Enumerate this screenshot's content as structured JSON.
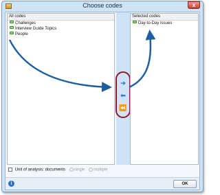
{
  "window": {
    "title": "Choose codes",
    "close_glyph": "x"
  },
  "all_codes": {
    "header": "All codes",
    "items": [
      "Challenges",
      "Interview Guide Topics",
      "People"
    ]
  },
  "selected_codes": {
    "header": "Selected codes",
    "items": [
      "Day-to-Day Issues"
    ]
  },
  "mover_buttons": [
    {
      "glyph": "➔",
      "icon": "arrow-right-icon"
    },
    {
      "glyph": "⬅",
      "icon": "arrow-left-icon"
    },
    {
      "glyph": "⏪",
      "icon": "arrow-double-left-icon"
    }
  ],
  "bottom": {
    "unit_label": "Unit of analysis: documents",
    "single_label": "single",
    "multiple_label": "multiple"
  },
  "footer": {
    "info_glyph": "i",
    "ok_label": "OK"
  },
  "colors": {
    "annotation_arrow": "#1f5f9e",
    "annotation_oval": "#8b1a2e"
  }
}
